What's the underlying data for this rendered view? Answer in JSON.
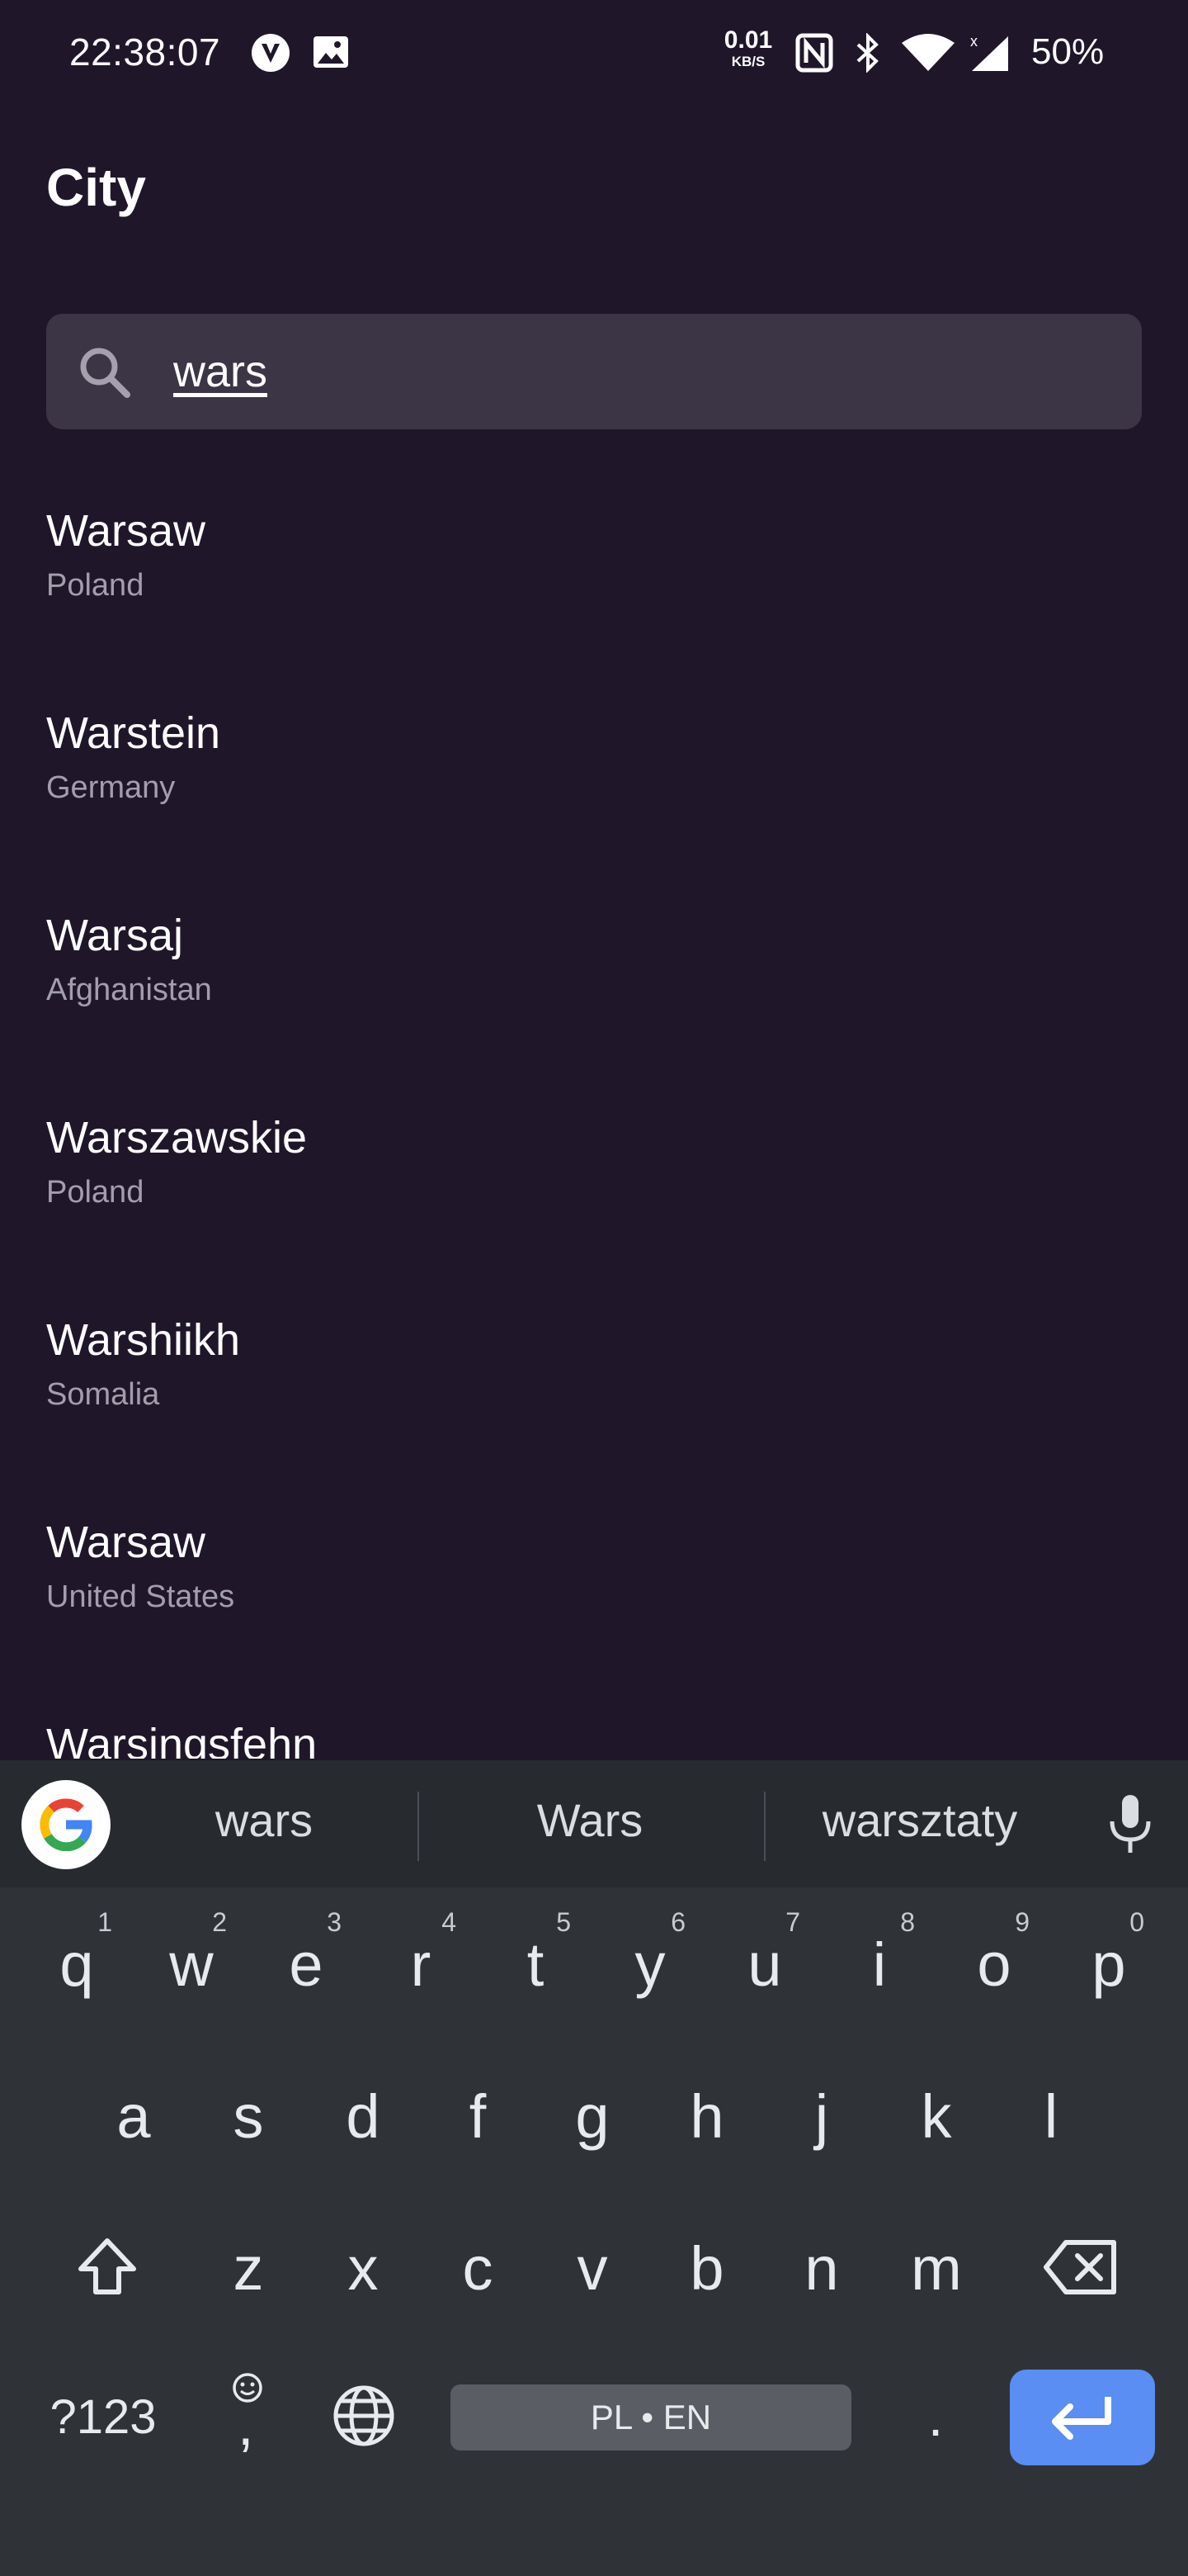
{
  "status_bar": {
    "time": "22:38:07",
    "speed_value": "0.01",
    "speed_unit": "KB/S",
    "battery": "50%"
  },
  "header": {
    "title": "City"
  },
  "search": {
    "value": "wars"
  },
  "results": [
    {
      "city": "Warsaw",
      "country": "Poland"
    },
    {
      "city": "Warstein",
      "country": "Germany"
    },
    {
      "city": "Warsaj",
      "country": "Afghanistan"
    },
    {
      "city": "Warszawskie",
      "country": "Poland"
    },
    {
      "city": "Warshiikh",
      "country": "Somalia"
    },
    {
      "city": "Warsaw",
      "country": "United States"
    },
    {
      "city": "Warsingsfehn",
      "country": ""
    }
  ],
  "keyboard": {
    "suggestions": [
      "wars",
      "Wars",
      "warsztaty"
    ],
    "row1": [
      {
        "k": "q",
        "n": "1"
      },
      {
        "k": "w",
        "n": "2"
      },
      {
        "k": "e",
        "n": "3"
      },
      {
        "k": "r",
        "n": "4"
      },
      {
        "k": "t",
        "n": "5"
      },
      {
        "k": "y",
        "n": "6"
      },
      {
        "k": "u",
        "n": "7"
      },
      {
        "k": "i",
        "n": "8"
      },
      {
        "k": "o",
        "n": "9"
      },
      {
        "k": "p",
        "n": "0"
      }
    ],
    "row2": [
      "a",
      "s",
      "d",
      "f",
      "g",
      "h",
      "j",
      "k",
      "l"
    ],
    "row3": [
      "z",
      "x",
      "c",
      "v",
      "b",
      "n",
      "m"
    ],
    "symbols_label": "?123",
    "emoji_comma": ",",
    "space_label": "PL • EN",
    "period": "."
  }
}
